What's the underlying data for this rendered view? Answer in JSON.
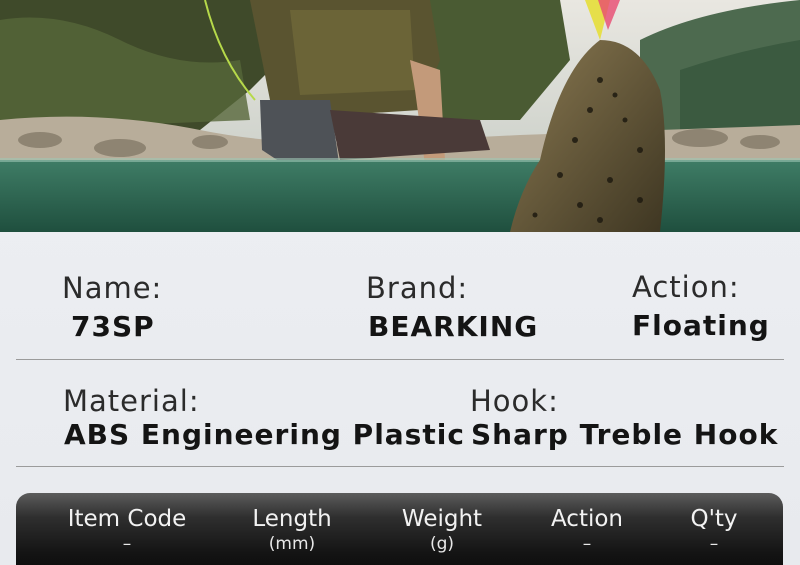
{
  "hero": {
    "scene": "angler-with-trout-photo"
  },
  "specs": {
    "name_label": "Name:",
    "name_value": "73SP",
    "brand_label": "Brand:",
    "brand_value": "BEARKING",
    "action_label": "Action:",
    "action_value": "Floating",
    "material_label": "Material:",
    "material_value": "ABS Engineering Plastic",
    "hook_label": "Hook:",
    "hook_value": "Sharp Treble Hook"
  },
  "table": {
    "columns": [
      {
        "title": "Item Code",
        "sub": "–"
      },
      {
        "title": "Length",
        "sub": "(mm)"
      },
      {
        "title": "Weight",
        "sub": "(g)"
      },
      {
        "title": "Action",
        "sub": "–"
      },
      {
        "title": "Q'ty",
        "sub": "–"
      }
    ]
  },
  "colors": {
    "header_dark": "#0b0b0b",
    "text_dark": "#141414",
    "water": "#2e6b55"
  }
}
